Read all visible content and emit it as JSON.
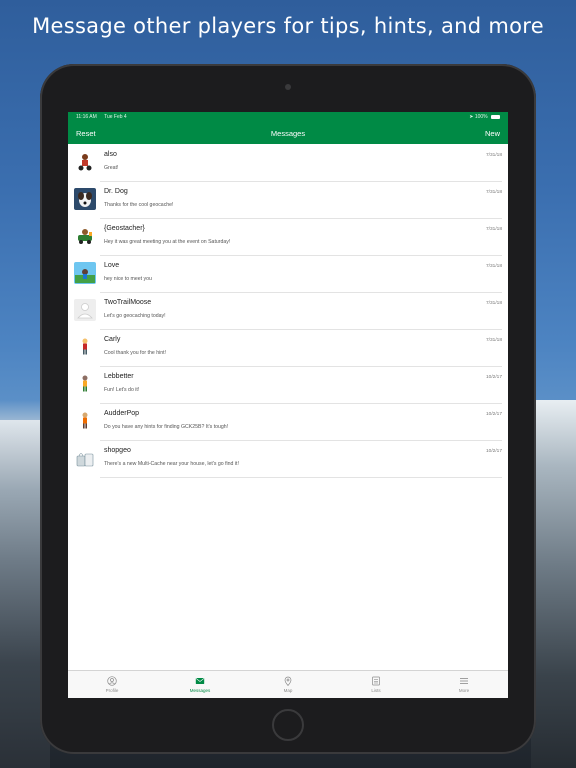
{
  "headline": "Message other players for tips, hints, and more",
  "status": {
    "time": "11:16 AM",
    "date": "Tue Feb 4",
    "battery": "100%"
  },
  "navbar": {
    "left": "Reset",
    "title": "Messages",
    "right": "New"
  },
  "messages": [
    {
      "name": "also",
      "preview": "Great!",
      "date": "7/31/18",
      "avatar": "scooter-rider-icon"
    },
    {
      "name": "Dr. Dog",
      "preview": "Thanks for the cool geocache!",
      "date": "7/31/18",
      "avatar": "dog-photo-icon"
    },
    {
      "name": "{Geostacher}",
      "preview": "Hey it was great meeting you at the event on Saturday!",
      "date": "7/31/18",
      "avatar": "dino-car-icon"
    },
    {
      "name": "Love",
      "preview": "hey nice to meet you",
      "date": "7/31/18",
      "avatar": "landscape-icon"
    },
    {
      "name": "TwoTrailMoose",
      "preview": "Let's go geocaching today!",
      "date": "7/31/18",
      "avatar": "placeholder-avatar-icon"
    },
    {
      "name": "Carly",
      "preview": "Cool thank you for the hint!",
      "date": "7/31/18",
      "avatar": "hiker-icon"
    },
    {
      "name": "Lebbetter",
      "preview": "Fun! Let's do it!",
      "date": "10/2/17",
      "avatar": "explorer-icon"
    },
    {
      "name": "AudderPop",
      "preview": "Do you have any hints for finding GCK25B? It's tough!",
      "date": "10/2/17",
      "avatar": "adventurer-icon"
    },
    {
      "name": "shopgeo",
      "preview": "There's a new Multi-Cache near your house, let's go find it!",
      "date": "10/2/17",
      "avatar": "cache-container-icon"
    }
  ],
  "tabs": [
    {
      "label": "Profile",
      "icon": "profile-icon",
      "active": false
    },
    {
      "label": "Messages",
      "icon": "messages-icon",
      "active": true
    },
    {
      "label": "Map",
      "icon": "map-pin-icon",
      "active": false
    },
    {
      "label": "Lists",
      "icon": "lists-icon",
      "active": false
    },
    {
      "label": "More",
      "icon": "menu-icon",
      "active": false
    }
  ],
  "colors": {
    "brand": "#008a45",
    "background_sky": "#3b6fb0"
  }
}
